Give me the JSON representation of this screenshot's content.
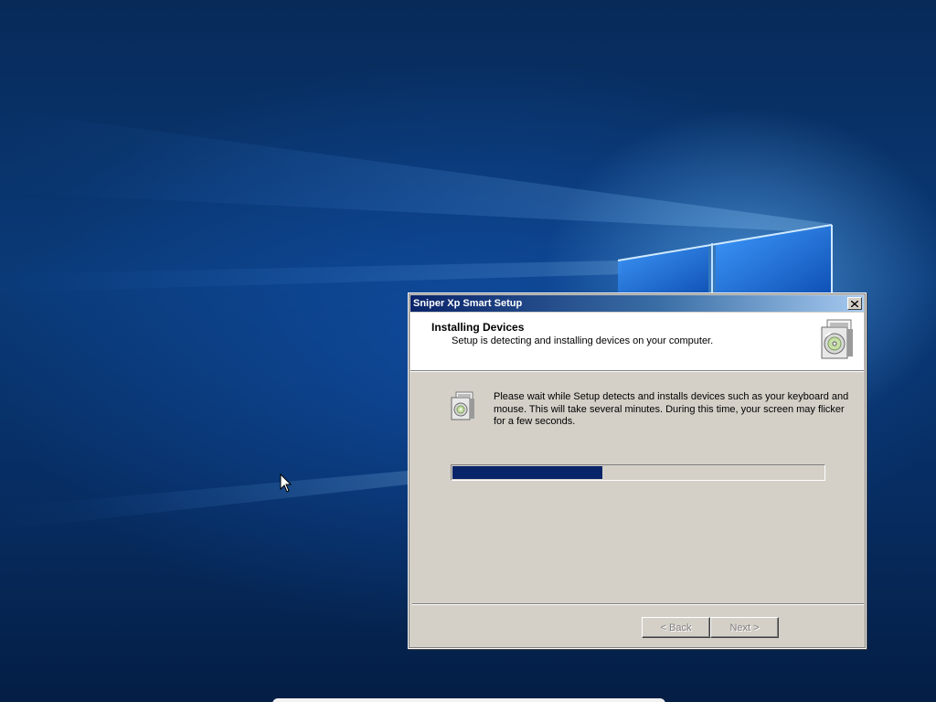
{
  "window": {
    "title": "Sniper Xp Smart Setup"
  },
  "header": {
    "title": "Installing Devices",
    "subtitle": "Setup is detecting and installing devices on your computer.",
    "icon": "setup-disk-icon"
  },
  "body": {
    "message": "Please wait while Setup detects and installs devices such as your keyboard and mouse.  This will take several minutes.  During this time, your screen may flicker for a few seconds.",
    "icon": "setup-box-icon"
  },
  "progress": {
    "fraction": 0.405,
    "fill_color": "#0a246a"
  },
  "buttons": {
    "back_label": "< Back",
    "next_label": "Next >",
    "back_enabled": false,
    "next_enabled": false
  },
  "colors": {
    "dialog_face": "#d4d0c8",
    "title_gradient_start": "#0a246a",
    "title_gradient_end": "#a6caf0",
    "desktop": "#0a3a78"
  }
}
